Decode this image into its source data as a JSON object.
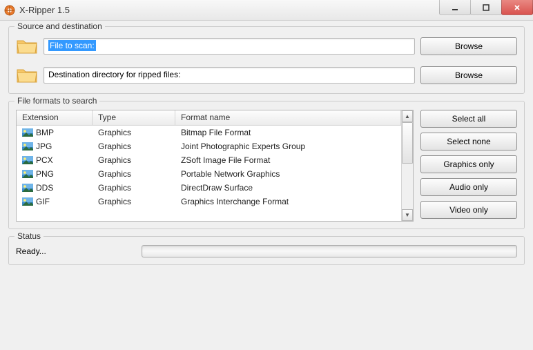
{
  "window": {
    "title": "X-Ripper 1.5"
  },
  "source": {
    "group_title": "Source and destination",
    "file_to_scan": "File to scan:",
    "dest_dir": "Destination directory for ripped files:",
    "browse_label": "Browse"
  },
  "formats": {
    "group_title": "File formats to search",
    "columns": {
      "ext": "Extension",
      "type": "Type",
      "name": "Format name"
    },
    "rows": [
      {
        "ext": "BMP",
        "type": "Graphics",
        "name": "Bitmap File Format"
      },
      {
        "ext": "JPG",
        "type": "Graphics",
        "name": "Joint Photographic Experts Group"
      },
      {
        "ext": "PCX",
        "type": "Graphics",
        "name": "ZSoft Image File Format"
      },
      {
        "ext": "PNG",
        "type": "Graphics",
        "name": "Portable Network Graphics"
      },
      {
        "ext": "DDS",
        "type": "Graphics",
        "name": "DirectDraw Surface"
      },
      {
        "ext": "GIF",
        "type": "Graphics",
        "name": "Graphics Interchange Format"
      }
    ],
    "buttons": {
      "select_all": "Select all",
      "select_none": "Select none",
      "graphics_only": "Graphics only",
      "audio_only": "Audio only",
      "video_only": "Video only"
    }
  },
  "status": {
    "group_title": "Status",
    "text": "Ready..."
  }
}
